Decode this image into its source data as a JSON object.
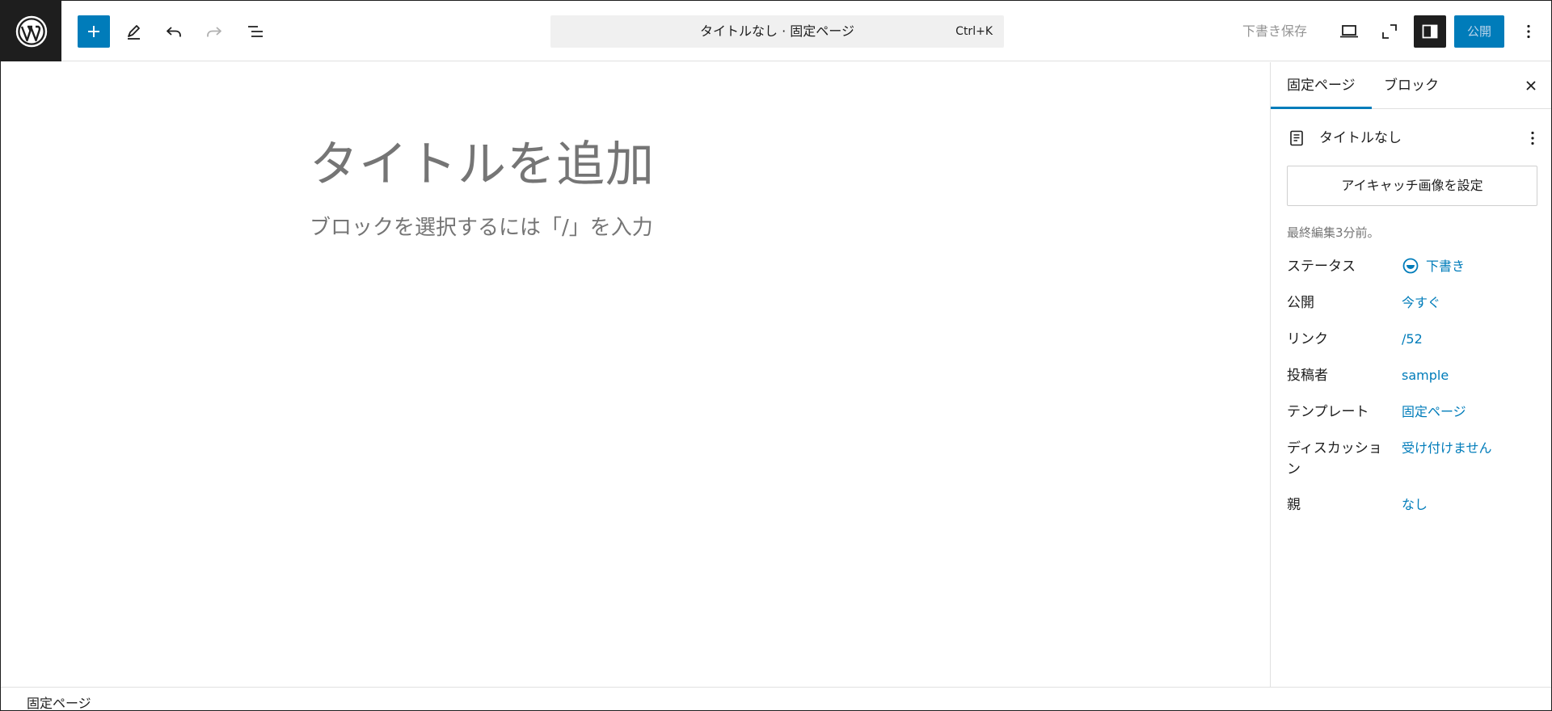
{
  "header": {
    "command_title": "タイトルなし · 固定ページ",
    "command_shortcut": "Ctrl+K",
    "save_draft_label": "下書き保存",
    "publish_label": "公開",
    "colors": {
      "accent": "#007cba",
      "dark": "#1e1e1e"
    },
    "icons": [
      "wordpress-logo-icon",
      "plus-icon",
      "pencil-icon",
      "undo-icon",
      "redo-icon",
      "list-view-icon",
      "desktop-preview-icon",
      "fullscreen-icon",
      "sidebar-settings-icon",
      "more-vertical-icon"
    ]
  },
  "canvas": {
    "title_placeholder": "タイトルを追加",
    "block_placeholder": "ブロックを選択するには「/」を入力"
  },
  "sidebar": {
    "tabs": [
      {
        "label": "固定ページ",
        "active": true
      },
      {
        "label": "ブロック",
        "active": false
      }
    ],
    "document_title": "タイトルなし",
    "featured_image_button": "アイキャッチ画像を設定",
    "last_edited": "最終編集3分前。",
    "meta": [
      {
        "label": "ステータス",
        "value": "下書き"
      },
      {
        "label": "公開",
        "value": "今すぐ"
      },
      {
        "label": "リンク",
        "value": "/52"
      },
      {
        "label": "投稿者",
        "value": "sample"
      },
      {
        "label": "テンプレート",
        "value": "固定ページ"
      },
      {
        "label": "ディスカッション",
        "value": "受け付けません"
      },
      {
        "label": "親",
        "value": "なし"
      }
    ]
  },
  "footer": {
    "breadcrumb": "固定ページ"
  }
}
